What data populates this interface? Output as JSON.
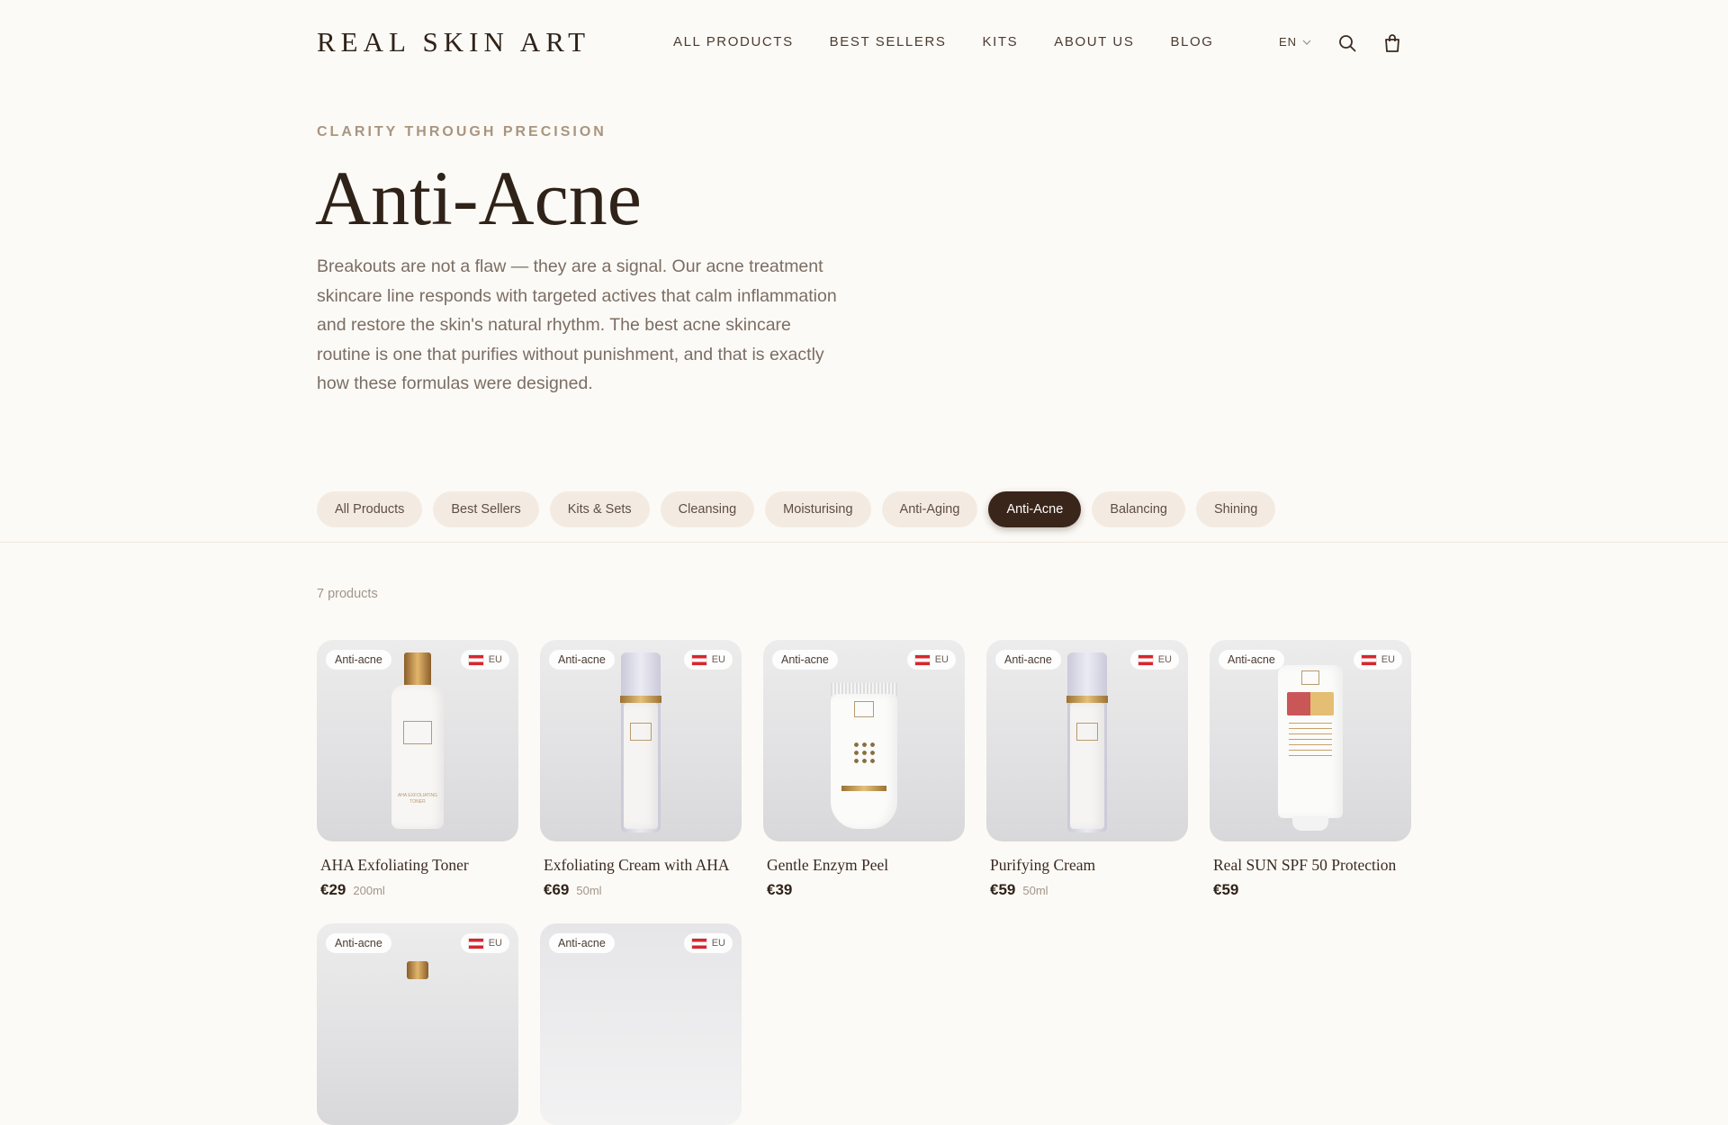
{
  "header": {
    "logo": "REAL SKIN ART",
    "nav": [
      "ALL PRODUCTS",
      "BEST SELLERS",
      "KITS",
      "ABOUT US",
      "BLOG"
    ],
    "language": "EN"
  },
  "hero": {
    "eyebrow": "CLARITY THROUGH PRECISION",
    "title": "Anti-Acne",
    "description": "Breakouts are not a flaw — they are a signal. Our acne treatment skincare line responds with targeted actives that calm inflammation and restore the skin's natural rhythm. The best acne skincare routine is one that purifies without punishment, and that is exactly how these formulas were designed."
  },
  "filters": {
    "items": [
      "All Products",
      "Best Sellers",
      "Kits & Sets",
      "Cleansing",
      "Moisturising",
      "Anti-Aging",
      "Anti-Acne",
      "Balancing",
      "Shining"
    ],
    "active": "Anti-Acne"
  },
  "results": {
    "count": "7 products"
  },
  "products": [
    {
      "tag": "Anti-acne",
      "region": "EU",
      "name": "AHA Exfoliating Toner",
      "price": "€29",
      "volume": "200ml",
      "icon": "toner-bottle"
    },
    {
      "tag": "Anti-acne",
      "region": "EU",
      "name": "Exfoliating Cream with AHA",
      "price": "€69",
      "volume": "50ml",
      "icon": "airless-pump-bottle"
    },
    {
      "tag": "Anti-acne",
      "region": "EU",
      "name": "Gentle Enzym Peel",
      "price": "€39",
      "volume": "",
      "icon": "tube"
    },
    {
      "tag": "Anti-acne",
      "region": "EU",
      "name": "Purifying Cream",
      "price": "€59",
      "volume": "50ml",
      "icon": "airless-pump-bottle"
    },
    {
      "tag": "Anti-acne",
      "region": "EU",
      "name": "Real SUN SPF 50 Protection",
      "price": "€59",
      "volume": "",
      "icon": "sunscreen-tube"
    },
    {
      "tag": "Anti-acne",
      "region": "EU",
      "icon": "product-image"
    },
    {
      "tag": "Anti-acne",
      "region": "EU",
      "icon": "product-image"
    }
  ],
  "colors": {
    "background": "#fcfaf6",
    "accent_dark": "#3a251a",
    "pill_bg": "#f3ebe2",
    "eyebrow": "#a9957f"
  }
}
